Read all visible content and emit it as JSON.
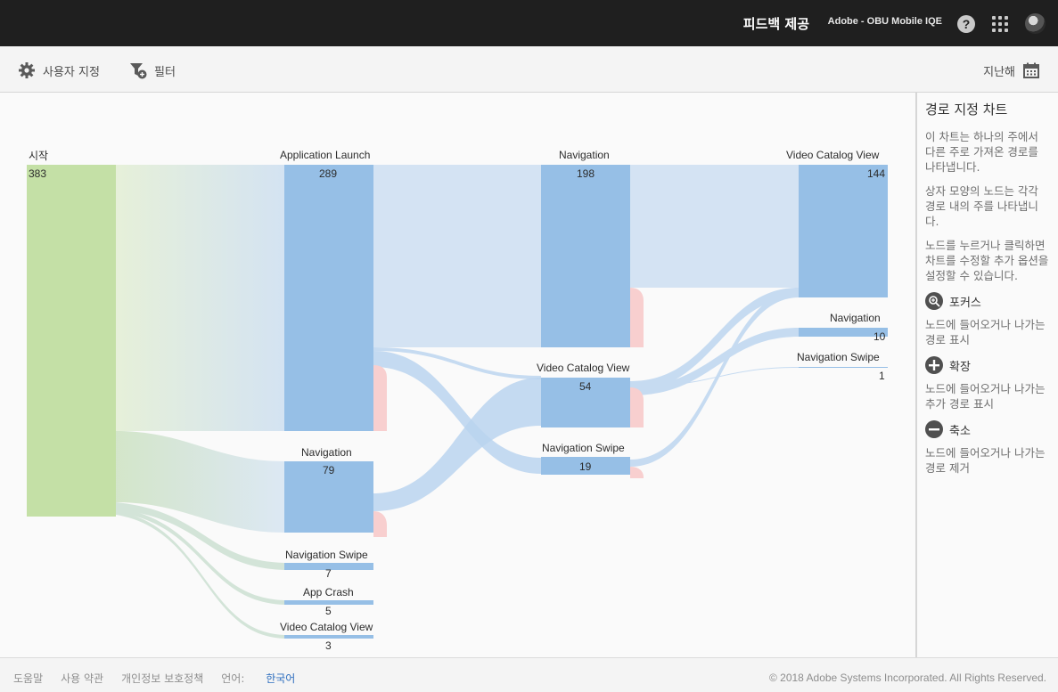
{
  "header": {
    "feedback": "피드백 제공",
    "org": "Adobe - OBU Mobile IQE",
    "help_glyph": "?"
  },
  "toolbar": {
    "customize_label": "사용자 지정",
    "filter_label": "필터",
    "date_label": "지난해"
  },
  "chart": {
    "columns": [
      {
        "nodes": [
          {
            "label": "시작",
            "count": "383",
            "color": "#c4e0a6"
          }
        ]
      },
      {
        "nodes": [
          {
            "label": "Application Launch",
            "count": "289",
            "color": "#96bfe6"
          },
          {
            "label": "Navigation",
            "count": "79",
            "color": "#96bfe6"
          },
          {
            "label": "Navigation Swipe",
            "count": "7",
            "color": "#96bfe6"
          },
          {
            "label": "App Crash",
            "count": "5",
            "color": "#96bfe6"
          },
          {
            "label": "Video Catalog View",
            "count": "3",
            "color": "#96bfe6"
          }
        ]
      },
      {
        "nodes": [
          {
            "label": "Navigation",
            "count": "198",
            "color": "#96bfe6"
          },
          {
            "label": "Video Catalog View",
            "count": "54",
            "color": "#96bfe6"
          },
          {
            "label": "Navigation Swipe",
            "count": "19",
            "color": "#96bfe6"
          }
        ]
      },
      {
        "nodes": [
          {
            "label": "Video Catalog View",
            "count": "144",
            "color": "#96bfe6"
          },
          {
            "label": "Navigation",
            "count": "10",
            "color": "#96bfe6"
          },
          {
            "label": "Navigation Swipe",
            "count": "1",
            "color": "#96bfe6"
          }
        ]
      }
    ],
    "colors": {
      "flow": "#cfe0f3",
      "exit": "#f8cfcf",
      "start": "#c4e0a6"
    }
  },
  "panel": {
    "title": "경로 지정 차트",
    "desc1": "이 차트는 하나의 주에서 다른 주로 가져온 경로를 나타냅니다.",
    "desc2": "상자 모양의 노드는 각각 경로 내의 주를 나타냅니다.",
    "desc3": "노드를 누르거나 클릭하면 차트를 수정할 추가 옵션을 설정할 수 있습니다.",
    "focus_label": "포커스",
    "focus_desc": "노드에 들어오거나 나가는 경로 표시",
    "expand_label": "확장",
    "expand_desc": "노드에 들어오거나 나가는 추가 경로 표시",
    "collapse_label": "축소",
    "collapse_desc": "노드에 들어오거나 나가는 경로 제거"
  },
  "footer": {
    "help": "도움말",
    "terms": "사용 약관",
    "privacy": "개인정보 보호정책",
    "language_label": "언어:",
    "language_value": "한국어",
    "copyright": "© 2018 Adobe Systems Incorporated. All Rights Reserved."
  }
}
